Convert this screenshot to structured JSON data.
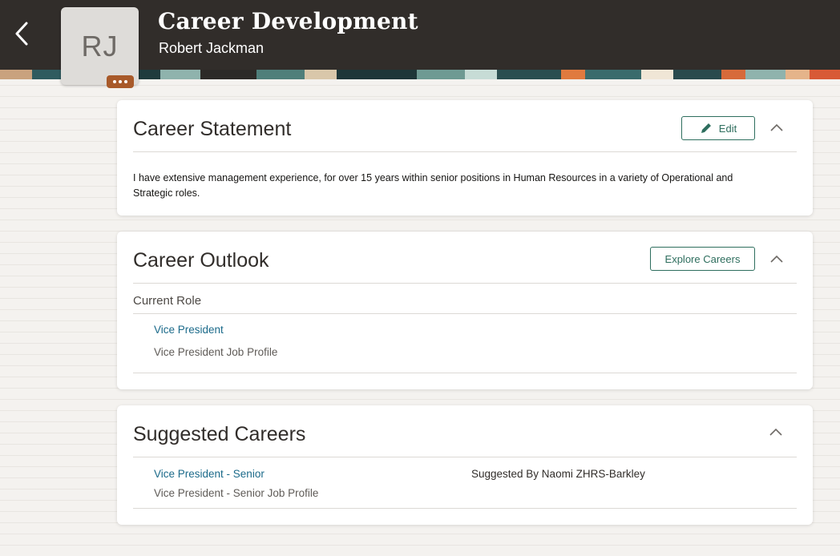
{
  "header": {
    "title": "Career Development",
    "subtitle": "Robert Jackman",
    "avatar_initials": "RJ",
    "icons": {
      "back": "chevron-left-icon",
      "more": "ellipsis-icon"
    }
  },
  "career_statement": {
    "title": "Career Statement",
    "edit_label": "Edit",
    "text": "I have extensive management experience, for over 15 years within senior positions in Human Resources in a variety of Operational and Strategic roles."
  },
  "career_outlook": {
    "title": "Career Outlook",
    "explore_label": "Explore Careers",
    "current_role_label": "Current Role",
    "role_name": "Vice President",
    "role_profile": "Vice President Job Profile"
  },
  "suggested_careers": {
    "title": "Suggested Careers",
    "items": [
      {
        "name": "Vice President - Senior",
        "profile": "Vice President - Senior Job Profile",
        "suggested_by": "Suggested By Naomi ZHRS-Barkley"
      }
    ]
  },
  "colors": {
    "header_bg": "#312d2a",
    "accent": "#2e6e5e",
    "link": "#1b6a8a",
    "avatar_badge": "#a85a2a"
  }
}
